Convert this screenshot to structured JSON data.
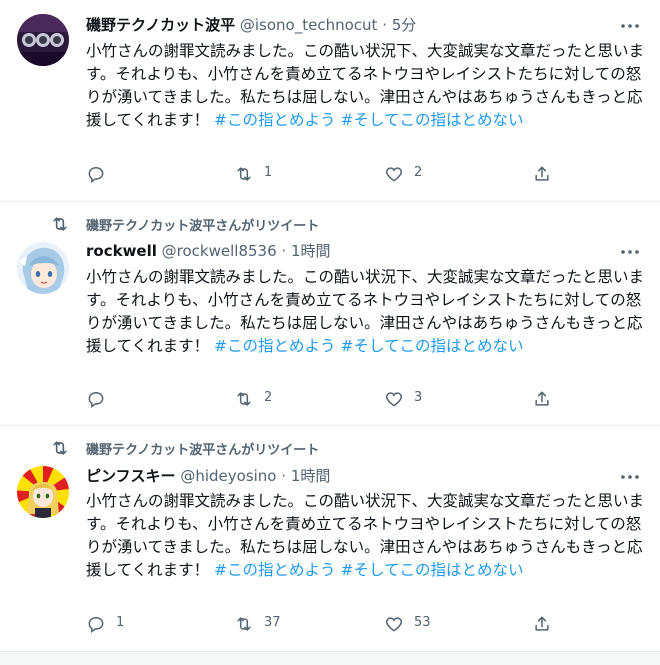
{
  "tweets": [
    {
      "retweeted_by": "",
      "name": "磯野テクノカット波平",
      "handle": "@isono_technocut",
      "time": "5分",
      "text_plain": "小竹さんの謝罪文読みました。この酷い状況下、大変誠実な文章だったと思います。それよりも、小竹さんを責め立てるネトウヨやレイシストたちに対しての怒りが湧いてきました。私たちは屈しない。津田さんやはあちゅうさんもきっと応援してくれます！",
      "hashtag1": "#この指とめよう",
      "hashtag2": "#そしてこの指はとめない",
      "replies": "",
      "retweets": "1",
      "likes": "2"
    },
    {
      "retweeted_by": "磯野テクノカット波平さんがリツイート",
      "name": "rockwell",
      "handle": "@rockwell8536",
      "time": "1時間",
      "text_plain": "小竹さんの謝罪文読みました。この酷い状況下、大変誠実な文章だったと思います。それよりも、小竹さんを責め立てるネトウヨやレイシストたちに対しての怒りが湧いてきました。私たちは屈しない。津田さんやはあちゅうさんもきっと応援してくれます！",
      "hashtag1": "#この指とめよう",
      "hashtag2": "#そしてこの指はとめない",
      "replies": "",
      "retweets": "2",
      "likes": "3"
    },
    {
      "retweeted_by": "磯野テクノカット波平さんがリツイート",
      "name": "ピンフスキー",
      "handle": "@hideyosino",
      "time": "1時間",
      "text_plain": "小竹さんの謝罪文読みました。この酷い状況下、大変誠実な文章だったと思います。それよりも、小竹さんを責め立てるネトウヨやレイシストたちに対しての怒りが湧いてきました。私たちは屈しない。津田さんやはあちゅうさんもきっと応援してくれます！",
      "hashtag1": "#この指とめよう",
      "hashtag2": "#そしてこの指はとめない",
      "replies": "1",
      "retweets": "37",
      "likes": "53"
    }
  ],
  "header_separator": "·",
  "icons": {
    "retweet": "retweet-icon",
    "reply": "reply-icon",
    "like": "heart-icon",
    "share": "share-icon",
    "more": "more-icon"
  },
  "colors": {
    "text": "#0f1419",
    "muted": "#536471",
    "hashtag": "#1d9bf0",
    "divider": "#e6ecf0"
  }
}
